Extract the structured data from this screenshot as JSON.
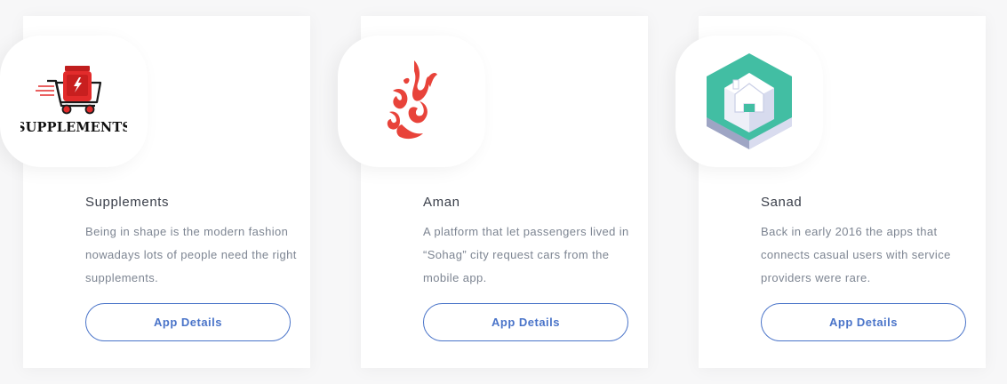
{
  "cards": [
    {
      "title": "Supplements",
      "description": "Being in shape is the modern fashion nowadays lots of people need the right supplements.",
      "button_label": "App Details",
      "logo_text": "SUPPLEMENTS",
      "logo_icon": "shopping-cart-with-supplement-jar",
      "accent": "#e22b2b"
    },
    {
      "title": "Aman",
      "description": "A platform that let passengers lived in “Sohag” city request cars from the mobile app.",
      "button_label": "App Details",
      "logo_icon": "arabic-calligraphy-logo",
      "accent": "#e8433a"
    },
    {
      "title": "Sanad",
      "description": "Back in early 2016 the apps that connects casual users with service providers were rare.",
      "button_label": "App Details",
      "logo_icon": "hexagon-house-logo",
      "accent": "#3fbfa0"
    }
  ],
  "colors": {
    "button_border": "#4a74c9",
    "title_text": "#3a3f4a",
    "description_text": "#7d8592"
  }
}
